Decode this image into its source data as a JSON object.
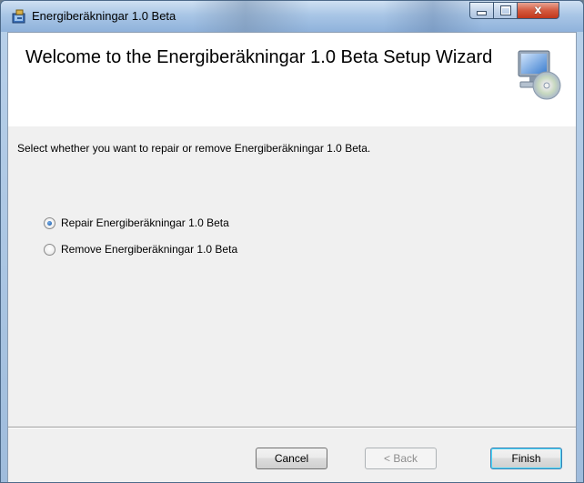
{
  "window": {
    "title": "Energiberäkningar 1.0 Beta",
    "close_glyph": "x"
  },
  "header": {
    "welcome": "Welcome to the Energiberäkningar 1.0 Beta Setup Wizard",
    "icon": "computer-disc-icon"
  },
  "body": {
    "instructions": "Select whether you want to repair or remove Energiberäkningar 1.0 Beta.",
    "options": [
      {
        "label": "Repair Energiberäkningar 1.0 Beta",
        "selected": true
      },
      {
        "label": "Remove Energiberäkningar 1.0 Beta",
        "selected": false
      }
    ]
  },
  "buttons": {
    "cancel": "Cancel",
    "back": "< Back",
    "finish": "Finish"
  },
  "colors": {
    "close_button": "#c1371b",
    "default_button_glow": "#48d8fb",
    "radio_dot": "#1e5fae"
  }
}
